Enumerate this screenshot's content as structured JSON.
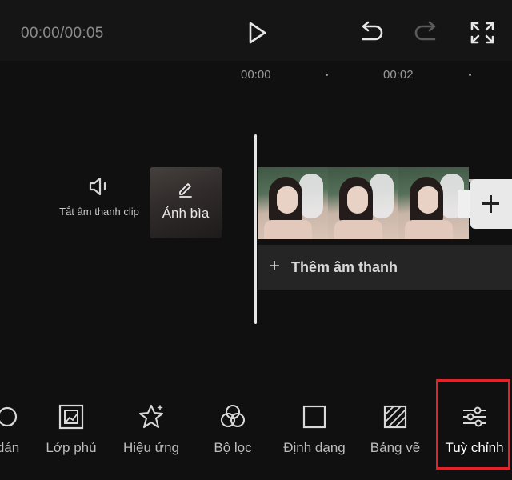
{
  "playback": {
    "timecode": "00:00/00:05"
  },
  "ruler": {
    "marks": [
      "00:00",
      "00:02"
    ]
  },
  "track": {
    "mute_label": "Tắt âm thanh clip",
    "cover_label": "Ảnh bìa",
    "add_audio_label": "Thêm âm thanh"
  },
  "toolbar": {
    "items": [
      {
        "label": "dán",
        "icon": "sticker-icon"
      },
      {
        "label": "Lớp phủ",
        "icon": "overlay-icon"
      },
      {
        "label": "Hiệu ứng",
        "icon": "effects-star-icon"
      },
      {
        "label": "Bộ lọc",
        "icon": "filter-icon"
      },
      {
        "label": "Định dạng",
        "icon": "format-square-icon"
      },
      {
        "label": "Bảng vẽ",
        "icon": "canvas-icon"
      },
      {
        "label": "Tuỳ chỉnh",
        "icon": "adjust-sliders-icon"
      }
    ],
    "highlighted_item": "Tuỳ chỉnh"
  },
  "colors": {
    "highlight": "#e2232a",
    "background": "#101010",
    "playbar": "#151515"
  }
}
